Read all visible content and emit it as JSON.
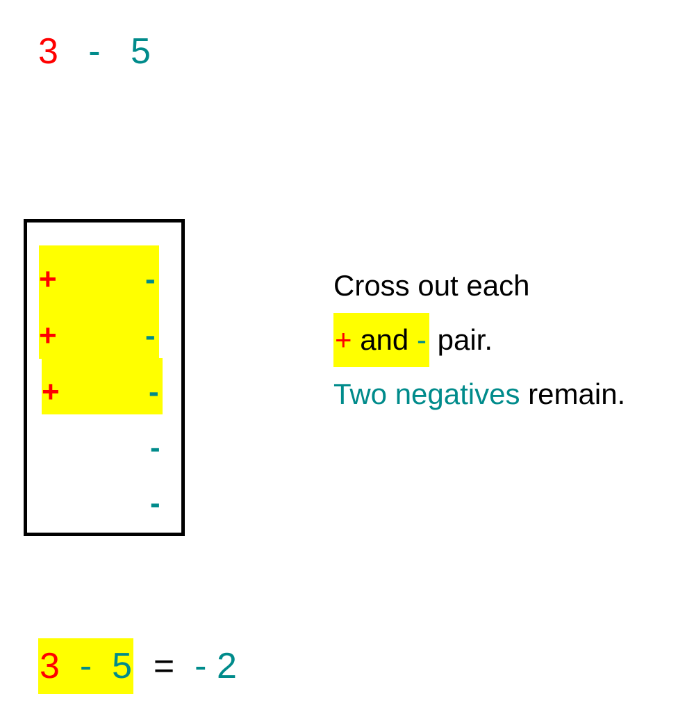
{
  "top_expression": {
    "left_operand": "3",
    "operator": "-",
    "right_operand": "5"
  },
  "counter_model": {
    "paired_rows": [
      {
        "positive": "+",
        "negative": "-"
      },
      {
        "positive": "+",
        "negative": "-"
      },
      {
        "positive": "+",
        "negative": "-"
      }
    ],
    "remaining_negatives": [
      "-",
      "-"
    ]
  },
  "instructions": {
    "line1": "Cross out each",
    "line2_plus": "+",
    "line2_and": " and ",
    "line2_minus": "-",
    "line2_rest": " pair.",
    "line3_colored": "Two negatives",
    "line3_rest": " remain."
  },
  "bottom_equation": {
    "left_operand": "3",
    "operator": "-",
    "right_operand": "5",
    "equals": "=",
    "result_sign": "-",
    "result_value": "2"
  },
  "colors": {
    "positive": "#ff0000",
    "negative": "#008b8b",
    "highlight": "#ffff00",
    "text": "#000000"
  }
}
